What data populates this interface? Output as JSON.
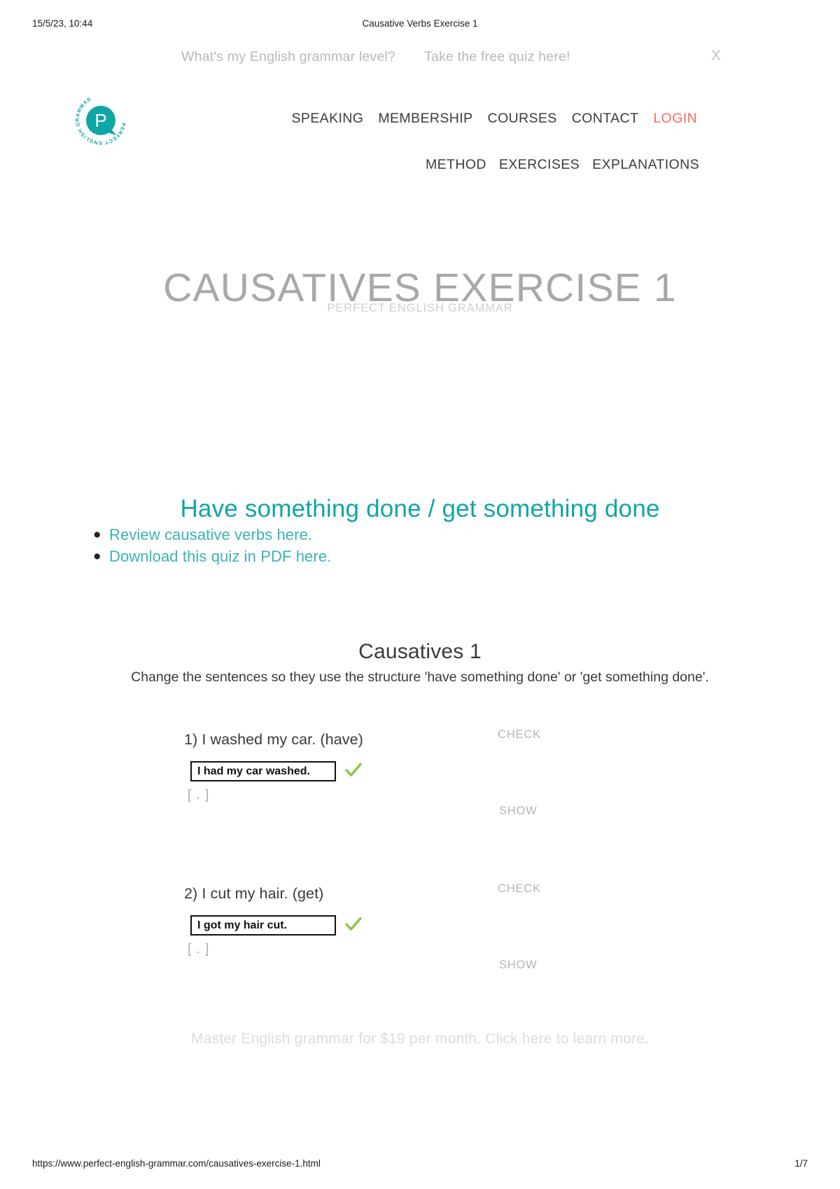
{
  "print": {
    "date": "15/5/23, 10:44",
    "doc_title": "Causative Verbs Exercise 1",
    "url": "https://www.perfect-english-grammar.com/causatives-exercise-1.html",
    "page": "1/7"
  },
  "promo": {
    "question": "What's my English grammar level?",
    "cta": "Take the free quiz here!",
    "close": "X"
  },
  "logo": {
    "letter": "P",
    "ring_text": "PERFECT ENGLISH GRAMMAR"
  },
  "nav": {
    "primary": [
      {
        "label": "SPEAKING",
        "accent": false
      },
      {
        "label": "MEMBERSHIP",
        "accent": false
      },
      {
        "label": "COURSES",
        "accent": false
      },
      {
        "label": "CONTACT",
        "accent": false
      },
      {
        "label": "LOGIN",
        "accent": true
      }
    ],
    "secondary": [
      {
        "label": "METHOD"
      },
      {
        "label": "EXERCISES"
      },
      {
        "label": "EXPLANATIONS"
      }
    ]
  },
  "header": {
    "title": "CAUSATIVES EXERCISE 1",
    "subtitle": "PERFECT ENGLISH GRAMMAR"
  },
  "content": {
    "section_heading": "Have something done / get something done",
    "links": [
      "Review causative verbs here.",
      "Download this quiz in PDF here."
    ]
  },
  "quiz": {
    "title": "Causatives 1",
    "instructions": "Change the sentences so they use the structure 'have something done' or 'get something done'.",
    "check_label": "CHECK",
    "show_label": "SHOW",
    "questions": [
      {
        "prompt": "1) I washed my car. (have)",
        "answer": "I had my car washed.",
        "feedback": "[ . ]",
        "correct": true
      },
      {
        "prompt": "2) I cut my hair. (get)",
        "answer": "I got my hair cut.",
        "feedback": "[ . ]",
        "correct": true
      }
    ]
  },
  "footer_promo": {
    "text": "Master English grammar for $19 per month. Click here to learn more."
  },
  "colors": {
    "teal": "#11a6a6",
    "link_teal": "#3bb3b3",
    "login_red": "#fa6b66",
    "tick_green": "#8cc63f",
    "muted": "#b5b5b5"
  }
}
